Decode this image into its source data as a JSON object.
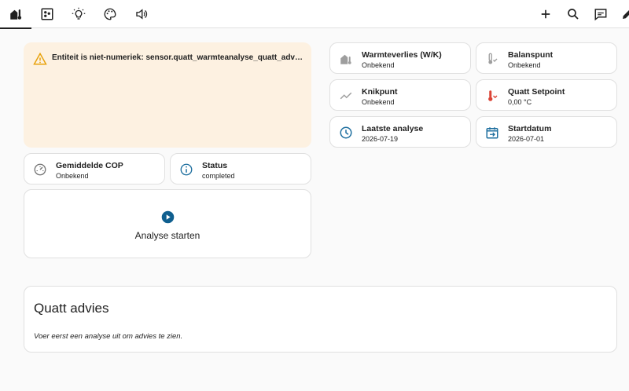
{
  "toolbar": {
    "tabs": [
      {
        "icon": "home-thermometer-icon"
      },
      {
        "icon": "grid-dashboard-icon"
      },
      {
        "icon": "lightbulb-icon"
      },
      {
        "icon": "palette-icon"
      },
      {
        "icon": "volume-speaker-icon"
      }
    ],
    "actions": [
      {
        "icon": "plus-icon"
      },
      {
        "icon": "search-icon"
      },
      {
        "icon": "assist-chat-icon"
      },
      {
        "icon": "pencil-icon"
      }
    ]
  },
  "warning": {
    "text": "Entiteit is niet-numeriek: sensor.quatt_warmteanalyse_quatt_advies_flowtemperatuur",
    "color": "#fdf1e1",
    "icon_color": "#e8a20c"
  },
  "tiles": {
    "gemiddelde_cop": {
      "name": "Gemiddelde COP",
      "state": "Onbekend"
    },
    "status": {
      "name": "Status",
      "state": "completed"
    },
    "warmteverlies": {
      "name": "Warmteverlies (W/K)",
      "state": "Onbekend"
    },
    "balanspunt": {
      "name": "Balanspunt",
      "state": "Onbekend"
    },
    "knikpunt": {
      "name": "Knikpunt",
      "state": "Onbekend"
    },
    "quatt_setpoint": {
      "name": "Quatt Setpoint",
      "state": "0,00 °C"
    },
    "laatste_analyse": {
      "name": "Laatste analyse",
      "state": "2026-07-19"
    },
    "startdatum": {
      "name": "Startdatum",
      "state": "2026-07-01"
    }
  },
  "action_button": {
    "label": "Analyse starten",
    "color": "#0f5f8f"
  },
  "advies": {
    "title": "Quatt advies",
    "message": "Voer eerst een analyse uit om advies te zien."
  },
  "colors": {
    "accent_blue": "#1e6f9f",
    "setpoint_red": "#db4437",
    "icon_grey": "#757575"
  }
}
